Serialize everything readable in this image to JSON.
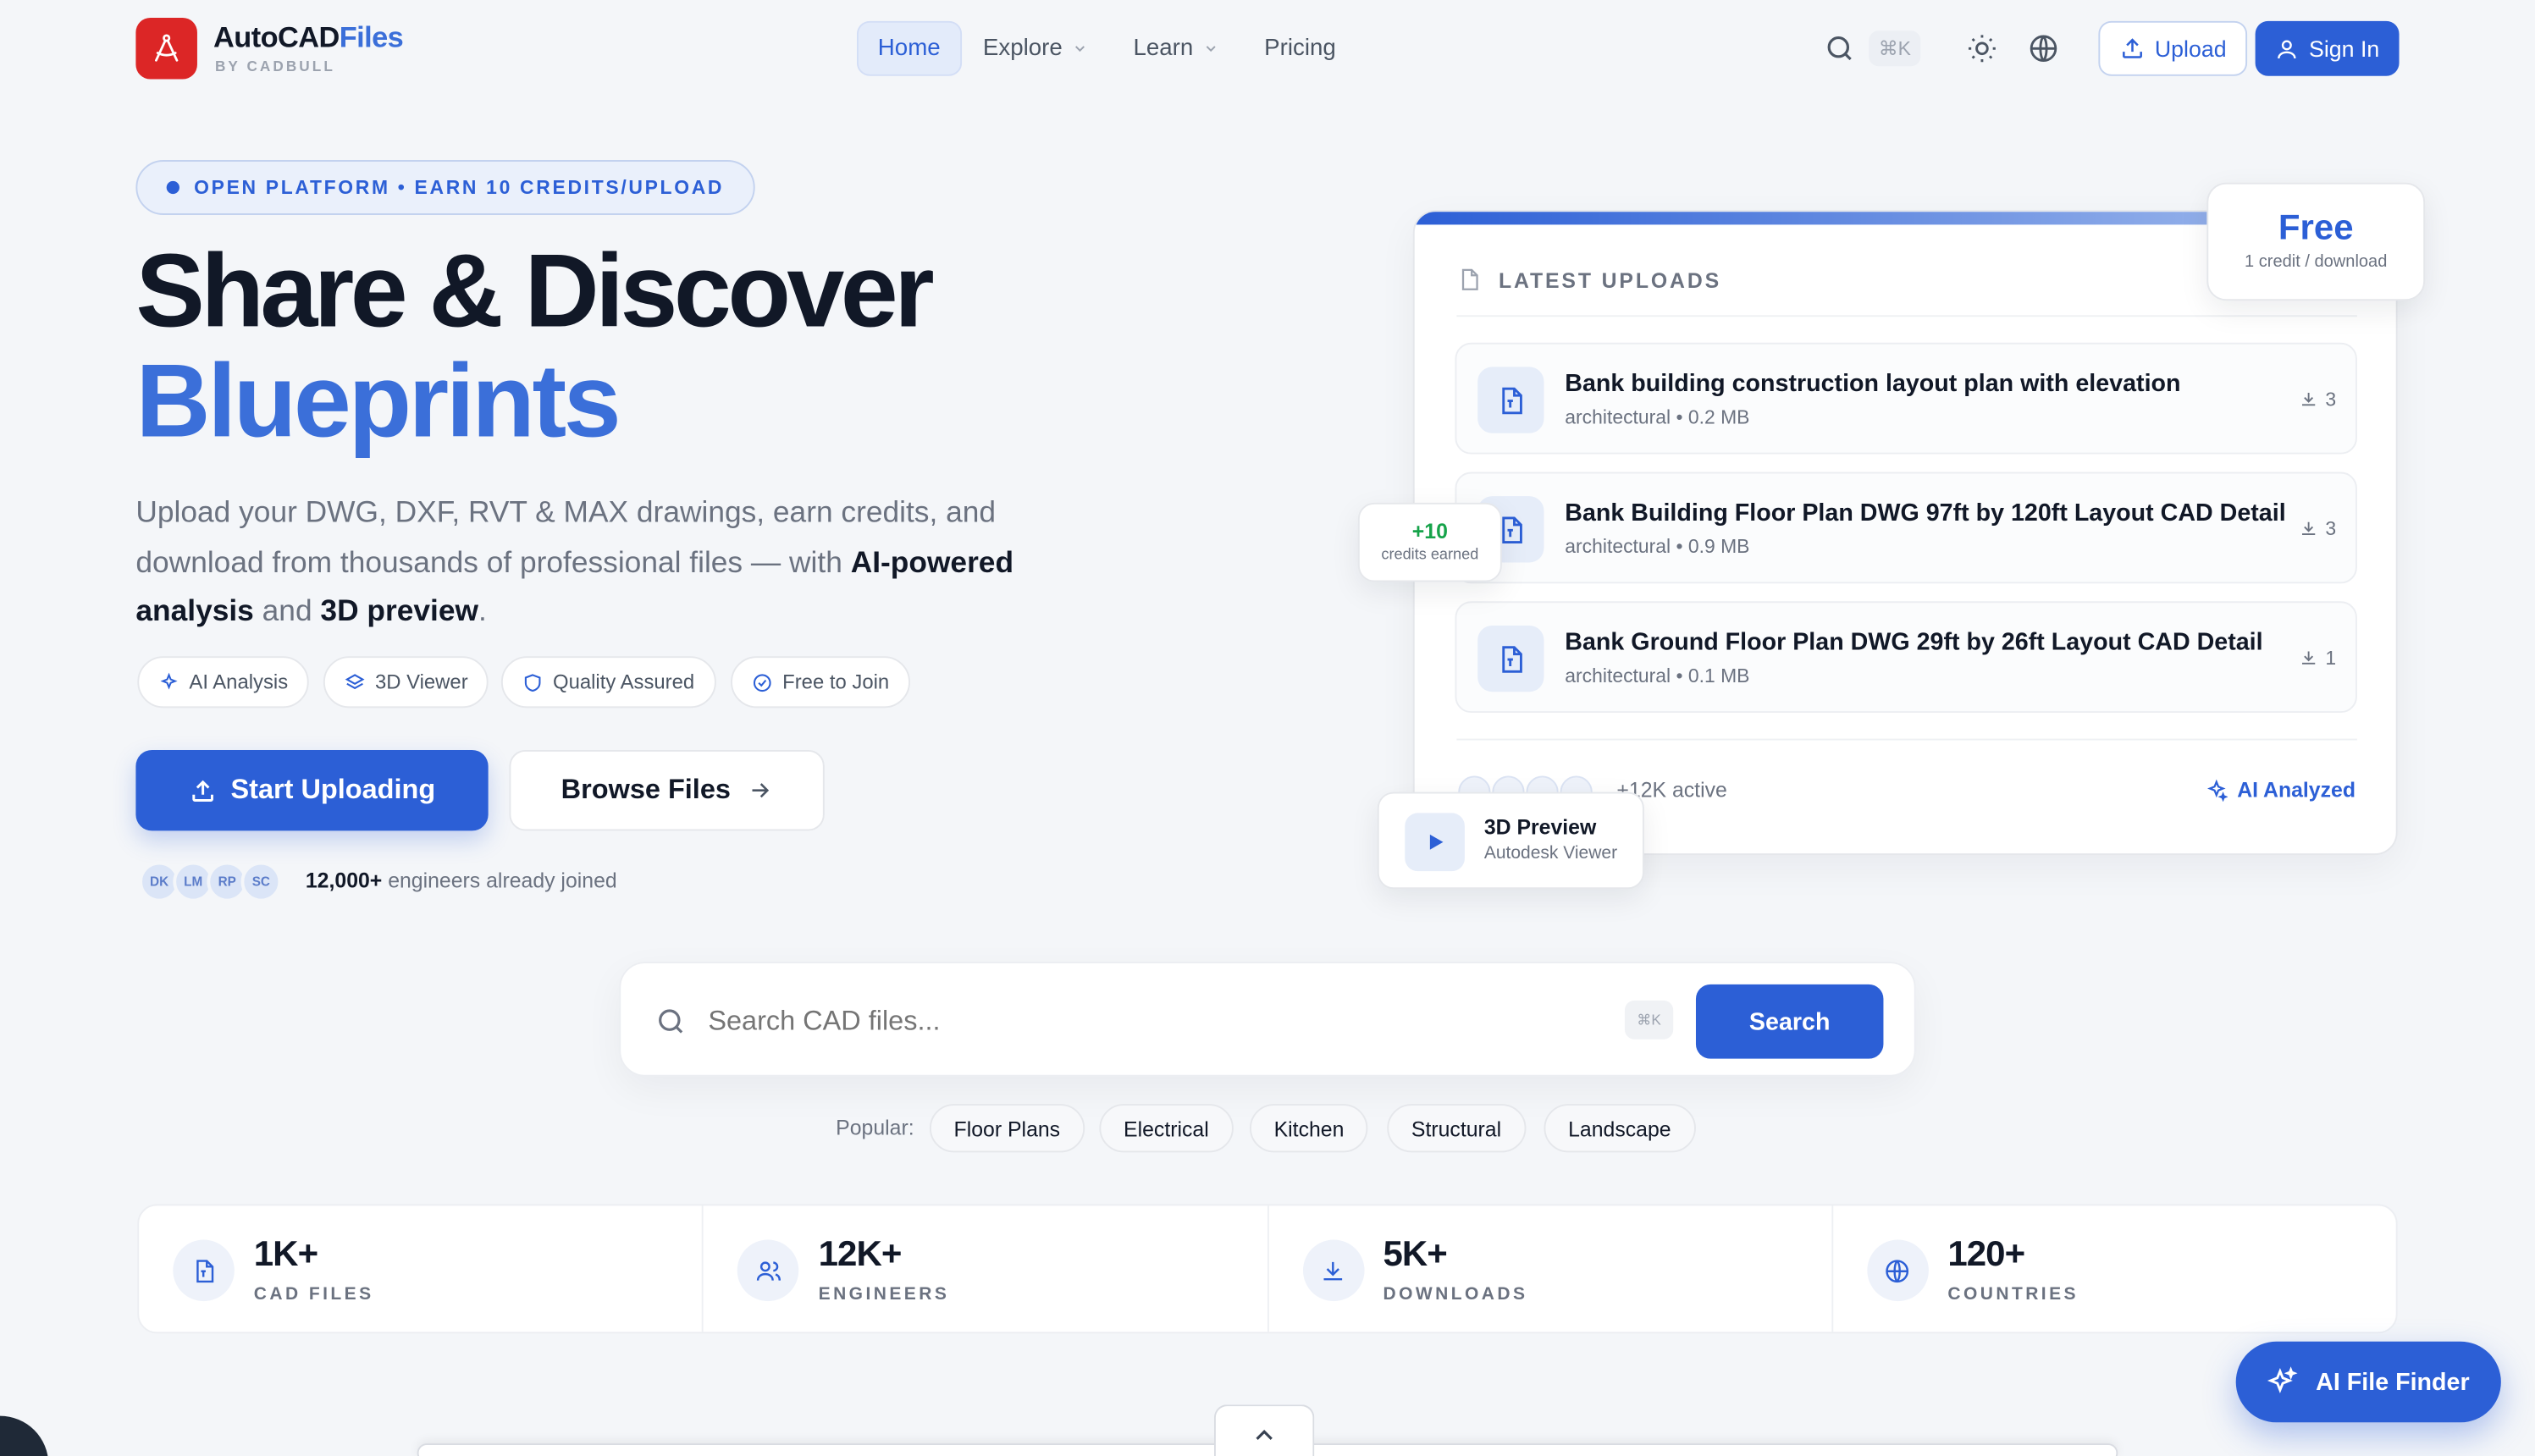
{
  "brand": {
    "name_part1": "AutoCAD",
    "name_part2": "Files",
    "subtitle": "BY CADBULL"
  },
  "nav": {
    "items": [
      {
        "label": "Home",
        "active": true,
        "dropdown": false
      },
      {
        "label": "Explore",
        "active": false,
        "dropdown": true
      },
      {
        "label": "Learn",
        "active": false,
        "dropdown": true
      },
      {
        "label": "Pricing",
        "active": false,
        "dropdown": false
      }
    ],
    "shortcut": "⌘K",
    "icons": [
      "search-icon",
      "sun-icon",
      "globe-icon"
    ],
    "upload_label": "Upload",
    "signin_label": "Sign In"
  },
  "hero": {
    "pill": "OPEN PLATFORM • EARN 10 CREDITS/UPLOAD",
    "title_line1": "Share & Discover",
    "title_line2": "Blueprints",
    "lead_a": "Upload your DWG, DXF, RVT & MAX drawings, earn credits, and download from thousands of professional files — with ",
    "lead_b": "AI-powered analysis",
    "lead_c": " and ",
    "lead_d": "3D preview",
    "lead_e": ".",
    "features": [
      "AI Analysis",
      "3D Viewer",
      "Quality Assured",
      "Free to Join"
    ],
    "start_label": "Start Uploading",
    "browse_label": "Browse Files",
    "avatars": [
      "DK",
      "LM",
      "RP",
      "SC"
    ],
    "joined_count": "12,000+",
    "joined_text": " engineers already joined"
  },
  "uploads": {
    "title": "LATEST UPLOADS",
    "items": [
      {
        "title": "Bank building construction layout plan with elevation",
        "meta": "architectural • 0.2 MB",
        "downloads": "3"
      },
      {
        "title": "Bank Building Floor Plan DWG 97ft by 120ft Layout CAD Detail",
        "meta": "architectural • 0.9 MB",
        "downloads": "3"
      },
      {
        "title": "Bank Ground Floor Plan DWG 29ft by 26ft Layout CAD Detail",
        "meta": "architectural • 0.1 MB",
        "downloads": "1"
      }
    ],
    "active_text": "+12K active",
    "ai_analyzed": "AI Analyzed"
  },
  "floats": {
    "free_big": "Free",
    "free_small": "1 credit / download",
    "credits_big": "+10",
    "credits_small": "credits earned",
    "preview_title": "3D Preview",
    "preview_sub": "Autodesk Viewer"
  },
  "search": {
    "placeholder": "Search CAD files...",
    "shortcut": "⌘K",
    "button": "Search",
    "popular_label": "Popular:",
    "tags": [
      "Floor Plans",
      "Electrical",
      "Kitchen",
      "Structural",
      "Landscape"
    ]
  },
  "stats": [
    {
      "value": "1K+",
      "label": "CAD FILES",
      "icon": "file-icon"
    },
    {
      "value": "12K+",
      "label": "ENGINEERS",
      "icon": "users-icon"
    },
    {
      "value": "5K+",
      "label": "DOWNLOADS",
      "icon": "download-icon"
    },
    {
      "value": "120+",
      "label": "COUNTRIES",
      "icon": "globe-icon"
    }
  ],
  "ai_finder": "AI File Finder",
  "colors": {
    "accent": "#2c5fd6",
    "brand_red": "#dc2626",
    "green": "#16a34a"
  }
}
